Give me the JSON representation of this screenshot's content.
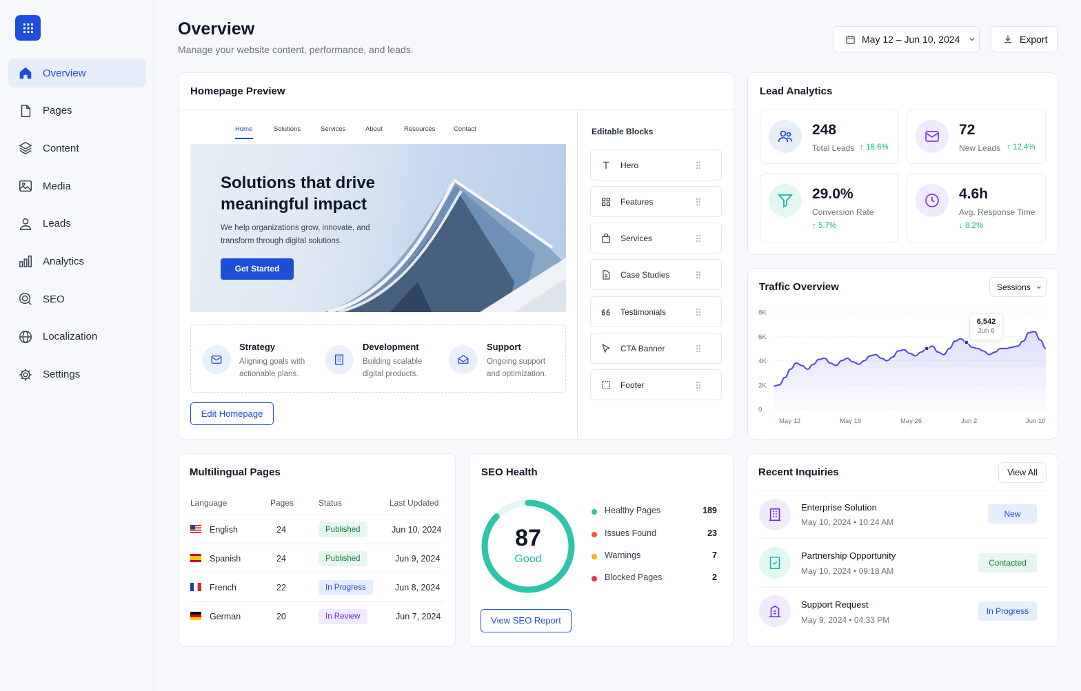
{
  "sidebar": {
    "items": [
      {
        "label": "Overview"
      },
      {
        "label": "Pages"
      },
      {
        "label": "Content"
      },
      {
        "label": "Media"
      },
      {
        "label": "Leads"
      },
      {
        "label": "Analytics"
      },
      {
        "label": "SEO"
      },
      {
        "label": "Localization"
      },
      {
        "label": "Settings"
      }
    ],
    "active_color": "#1d4ed8"
  },
  "header": {
    "title": "Overview",
    "subtitle": "Manage your website content, performance, and leads.",
    "date_range": "May 12 – Jun 10, 2024",
    "export_label": "Export"
  },
  "homepage": {
    "title": "Homepage Preview",
    "nav": [
      "Home",
      "Solutions",
      "Services",
      "About",
      "Resources",
      "Contact"
    ],
    "hero_title_1": "Solutions that drive",
    "hero_title_2": "meaningful impact",
    "hero_text_1": "We help organizations grow, innovate, and",
    "hero_text_2": "transform through digital solutions.",
    "cta": "Get Started",
    "features": [
      {
        "title": "Strategy",
        "line1": "Aligning goals with",
        "line2": "actionable plans.",
        "icon": "check-mail-icon"
      },
      {
        "title": "Development",
        "line1": "Building scalable",
        "line2": "digital products.",
        "icon": "building-icon"
      },
      {
        "title": "Support",
        "line1": "Ongoing support",
        "line2": "and optimization.",
        "icon": "support-icon"
      }
    ],
    "edit_label": "Edit Homepage",
    "blocks_title": "Editable Blocks",
    "blocks": [
      {
        "label": "Hero",
        "icon": "text-icon"
      },
      {
        "label": "Features",
        "icon": "grid-icon"
      },
      {
        "label": "Services",
        "icon": "bag-icon"
      },
      {
        "label": "Case Studies",
        "icon": "document-icon"
      },
      {
        "label": "Testimonials",
        "icon": "quote-icon"
      },
      {
        "label": "CTA Banner",
        "icon": "pointer-icon"
      },
      {
        "label": "Footer",
        "icon": "frame-icon"
      }
    ]
  },
  "leads": {
    "title": "Lead Analytics",
    "stats": [
      {
        "value": "248",
        "label": "Total Leads",
        "delta": "18.6%",
        "direction": "up",
        "icon": "users-icon"
      },
      {
        "value": "72",
        "label": "New Leads",
        "delta": "12.4%",
        "direction": "up",
        "icon": "mail-icon"
      },
      {
        "value": "29.0%",
        "label": "Conversion Rate",
        "delta": "5.7%",
        "direction": "up",
        "icon": "funnel-icon"
      },
      {
        "value": "4.6h",
        "label": "Avg. Response Time",
        "delta": "8.2%",
        "direction": "down",
        "icon": "clock-icon"
      }
    ]
  },
  "traffic": {
    "title": "Traffic Overview",
    "metric_select": "Sessions",
    "tooltip_value": "6,542",
    "tooltip_date": "Jun 6"
  },
  "chart_data": {
    "type": "area",
    "title": "Traffic Overview",
    "series": [
      {
        "name": "Sessions",
        "values": [
          1900,
          2000,
          2600,
          3300,
          3800,
          3600,
          3300,
          3700,
          4100,
          4200,
          3800,
          3600,
          4000,
          4200,
          3900,
          3700,
          4000,
          4400,
          4500,
          4200,
          4000,
          4300,
          4800,
          4900,
          4600,
          4400,
          4700,
          5000,
          5200,
          4700,
          4500,
          5000,
          5600,
          5800,
          5500,
          5100,
          5000,
          4800,
          4500,
          4700,
          5000,
          5000,
          5100,
          5200,
          5600,
          6300,
          6400,
          5700,
          5000
        ]
      }
    ],
    "x_start": "May 12",
    "x_end": "Jun 10",
    "xticks": [
      "May  12",
      "May  19",
      "May  26",
      "Jun  2",
      "Jun  10"
    ],
    "yticks": [
      "0",
      "2K",
      "4K",
      "6K",
      "8K"
    ],
    "ylim": [
      0,
      8000
    ],
    "grid": true,
    "line_color": "#4f46e5"
  },
  "multilingual": {
    "title": "Multilingual Pages",
    "headers": [
      "Language",
      "Pages",
      "Status",
      "Last Updated"
    ],
    "rows": [
      {
        "flag": "us-flag-icon",
        "language": "English",
        "pages": "24",
        "status": "Published",
        "updated": "Jun 10, 2024"
      },
      {
        "flag": "es-flag-icon",
        "language": "Spanish",
        "pages": "24",
        "status": "Published",
        "updated": "Jun 9, 2024"
      },
      {
        "flag": "fr-flag-icon",
        "language": "French",
        "pages": "22",
        "status": "In Progress",
        "updated": "Jun 8, 2024"
      },
      {
        "flag": "de-flag-icon",
        "language": "German",
        "pages": "20",
        "status": "In Review",
        "updated": "Jun 7, 2024"
      }
    ]
  },
  "seo": {
    "title": "SEO Health",
    "score": "87",
    "score_pct": 87,
    "score_label": "Good",
    "items": [
      {
        "label": "Healthy Pages",
        "value": "189",
        "color": "#2ec4a8"
      },
      {
        "label": "Issues Found",
        "value": "23",
        "color": "#f05a28"
      },
      {
        "label": "Warnings",
        "value": "7",
        "color": "#f5b50a"
      },
      {
        "label": "Blocked Pages",
        "value": "2",
        "color": "#e5334e"
      }
    ],
    "report_label": "View SEO Report"
  },
  "inquiries": {
    "title": "Recent Inquiries",
    "view_all": "View All",
    "items": [
      {
        "title": "Enterprise Solution",
        "date": "May 10, 2024",
        "time": "10:24 AM",
        "status": "New",
        "icon": "building-icon"
      },
      {
        "title": "Partnership Opportunity",
        "date": "May 10, 2024",
        "time": "09:18 AM",
        "status": "Contacted",
        "icon": "handshake-doc-icon"
      },
      {
        "title": "Support Request",
        "date": "May 9, 2024",
        "time": "04:33 PM",
        "status": "In Progress",
        "icon": "office-icon"
      }
    ]
  }
}
